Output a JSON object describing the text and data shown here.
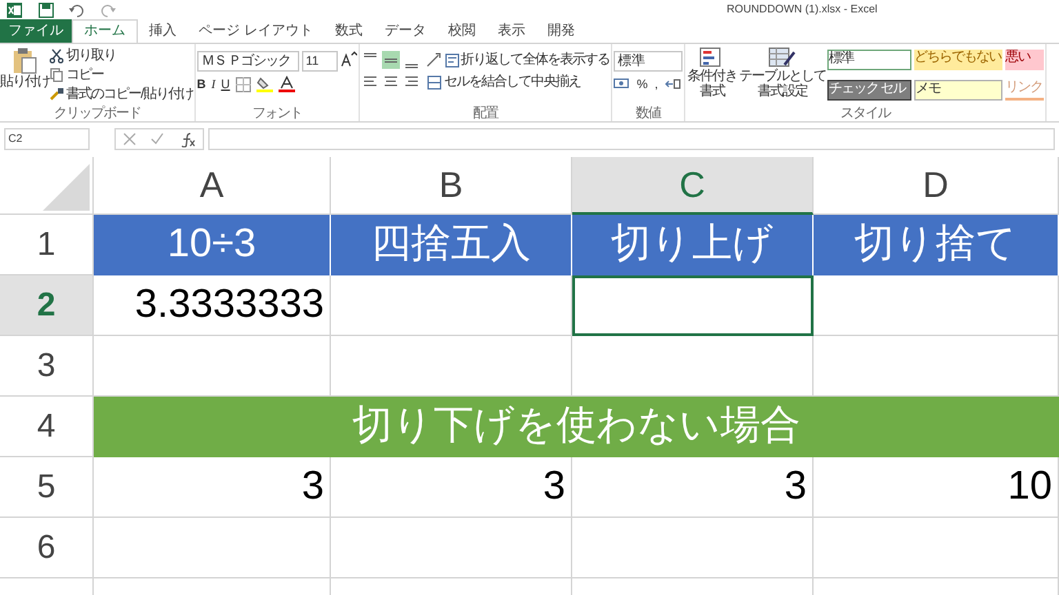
{
  "window": {
    "title": "ROUNDDOWN (1).xlsx - Excel"
  },
  "tabs": [
    {
      "label": "ファイル",
      "kind": "file",
      "selected": false
    },
    {
      "label": "ホーム",
      "kind": "tab",
      "selected": true
    },
    {
      "label": "挿入",
      "kind": "tab",
      "selected": false
    },
    {
      "label": "ページ レイアウト",
      "kind": "tab",
      "selected": false
    },
    {
      "label": "数式",
      "kind": "tab",
      "selected": false
    },
    {
      "label": "データ",
      "kind": "tab",
      "selected": false
    },
    {
      "label": "校閲",
      "kind": "tab",
      "selected": false
    },
    {
      "label": "表示",
      "kind": "tab",
      "selected": false
    },
    {
      "label": "開発",
      "kind": "tab",
      "selected": false
    }
  ],
  "clipboard": {
    "paste": "貼り付け",
    "cut": "切り取り",
    "copy": "コピー",
    "format_painter": "書式のコピー/貼り付け",
    "label": "クリップボード"
  },
  "font": {
    "name": "ＭＳ Ｐゴシック",
    "size": "11",
    "bold": "B",
    "italic": "I",
    "underline": "U",
    "label": "フォント"
  },
  "alignment": {
    "align_buttons": [
      {
        "kind": "top",
        "selected": false
      },
      {
        "kind": "middle",
        "selected": true
      },
      {
        "kind": "bottom",
        "selected": false
      }
    ],
    "wrap": "折り返して全体を表示する",
    "merge": "セルを結合して中央揃え",
    "label": "配置"
  },
  "number": {
    "format": "標準",
    "percent": "%",
    "comma": ",",
    "label": "数値"
  },
  "styles": {
    "conditional": "条件付き書式",
    "table": "テーブルとして書式設定",
    "cells": [
      {
        "label": "標準",
        "kind": "normal"
      },
      {
        "label": "どちらでもない",
        "kind": "neutral"
      },
      {
        "label": "悪い",
        "kind": "bad"
      },
      {
        "label": "チェック セル",
        "kind": "check"
      },
      {
        "label": "メモ",
        "kind": "note"
      },
      {
        "label": "リンク",
        "kind": "link"
      }
    ],
    "label": "スタイル"
  },
  "formula_bar": {
    "name_box": "C2"
  },
  "sheet": {
    "columns": [
      {
        "label": "A",
        "selected": false
      },
      {
        "label": "B",
        "selected": false
      },
      {
        "label": "C",
        "selected": true
      },
      {
        "label": "D",
        "selected": false
      }
    ],
    "rows": [
      {
        "header": "1",
        "selected": false,
        "cells": [
          {
            "text": "10÷3",
            "kind": "title",
            "selected": false
          },
          {
            "text": "四捨五入",
            "kind": "title",
            "selected": false
          },
          {
            "text": "切り上げ",
            "kind": "title",
            "selected": false
          },
          {
            "text": "切り捨て",
            "kind": "title",
            "selected": false
          }
        ]
      },
      {
        "header": "2",
        "selected": true,
        "cells": [
          {
            "text": "3.3333333",
            "kind": "value",
            "selected": false
          },
          {
            "kind": "value",
            "selected": false
          },
          {
            "kind": "value",
            "selected": true
          },
          {
            "kind": "value",
            "selected": false
          }
        ]
      },
      {
        "header": "3",
        "selected": false
      },
      {
        "header": "4",
        "selected": false,
        "banner": {
          "text": "切り下げを使わない場合",
          "selected": false
        }
      },
      {
        "header": "5",
        "selected": false,
        "cells": [
          {
            "text": "3",
            "kind": "value",
            "selected": false
          },
          {
            "text": "3",
            "kind": "value",
            "selected": false
          },
          {
            "text": "3",
            "kind": "value",
            "selected": false
          },
          {
            "text": "10",
            "kind": "value",
            "selected": false
          }
        ]
      },
      {
        "header": "6",
        "selected": false
      },
      {
        "selected": false
      }
    ]
  }
}
